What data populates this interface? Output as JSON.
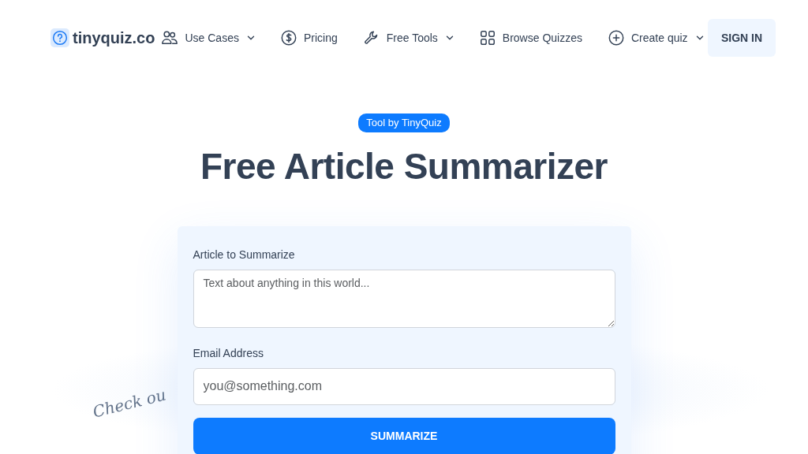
{
  "brand": {
    "name": "tinyquiz.co"
  },
  "nav": [
    {
      "label": "Use Cases",
      "dropdown": true
    },
    {
      "label": "Pricing",
      "dropdown": false
    },
    {
      "label": "Free Tools",
      "dropdown": true
    },
    {
      "label": "Browse Quizzes",
      "dropdown": false
    },
    {
      "label": "Create quiz",
      "dropdown": true
    }
  ],
  "sign_in": "SIGN IN",
  "badge": "Tool by TinyQuiz",
  "heading": "Free Article Summarizer",
  "side_note": "Check ou",
  "form": {
    "fields": [
      {
        "kind": "textarea",
        "label": "Article to Summarize",
        "placeholder": "Text about anything in this world..."
      },
      {
        "kind": "input",
        "label": "Email Address",
        "placeholder": "you@something.com"
      }
    ],
    "submit": "SUMMARIZE"
  }
}
